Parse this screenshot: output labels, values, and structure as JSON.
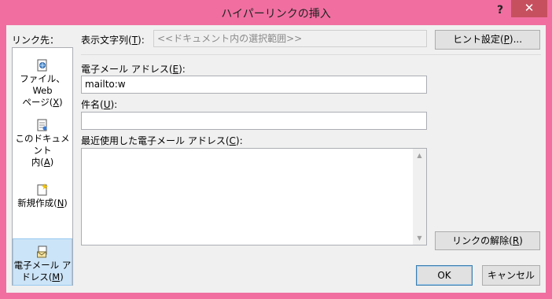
{
  "window": {
    "title": "ハイパーリンクの挿入",
    "help": "?",
    "close": "✕"
  },
  "sidebar": {
    "caption": "リンク先：",
    "items": [
      {
        "line1": "ファイル、Web",
        "line2_pre": "ページ(",
        "key": "X",
        "line2_post": ")",
        "icon": "web-page-icon",
        "selected": false
      },
      {
        "line1": "このドキュメント",
        "line2_pre": "内(",
        "key": "A",
        "line2_post": ")",
        "icon": "document-place-icon",
        "selected": false
      },
      {
        "line1": "",
        "line2_pre": "新規作成(",
        "key": "N",
        "line2_post": ")",
        "icon": "new-document-icon",
        "selected": false
      },
      {
        "line1": "電子メール ア",
        "line2_pre": "ドレス(",
        "key": "M",
        "line2_post": ")",
        "icon": "email-icon",
        "selected": true
      }
    ]
  },
  "display_text": {
    "label_pre": "表示文字列(",
    "key": "T",
    "label_post": "):",
    "value": "<<ドキュメント内の選択範囲>>"
  },
  "screentip_button": {
    "pre": "ヒント設定(",
    "key": "P",
    "post": ")..."
  },
  "email_address": {
    "label_pre": "電子メール アドレス(",
    "key": "E",
    "label_post": "):",
    "value": "mailto:w"
  },
  "subject": {
    "label_pre": "件名(",
    "key": "U",
    "label_post": "):",
    "value": ""
  },
  "recent": {
    "label_pre": "最近使用した電子メール アドレス(",
    "key": "C",
    "label_post": "):",
    "items": []
  },
  "remove_link_button": {
    "pre": "リンクの解除(",
    "key": "R",
    "post": ")"
  },
  "ok_button": "OK",
  "cancel_button": "キャンセル",
  "colors": {
    "titlebar": "#f06fa0",
    "close": "#c7505f",
    "selected": "#cce4f7"
  }
}
